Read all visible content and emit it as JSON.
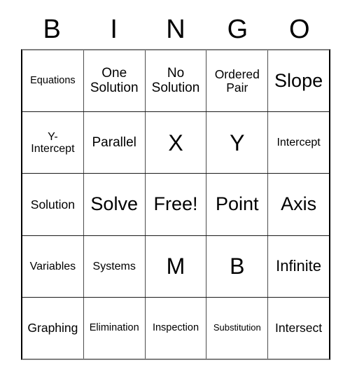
{
  "card": {
    "title": "BINGO",
    "header_letters": [
      "B",
      "I",
      "N",
      "G",
      "O"
    ],
    "free_space_label": "Free!",
    "free_space_position": {
      "row": 3,
      "column": 3
    },
    "grid_size": "5x5",
    "colors": {
      "background": "#ffffff",
      "text": "#000000",
      "grid_line": "#4d4d4d",
      "grid_border": "#000000"
    }
  },
  "grid": {
    "rows": [
      {
        "cells": [
          {
            "text": "Equations",
            "size": "s"
          },
          {
            "text": "One\nSolution",
            "size": "l"
          },
          {
            "text": "No\nSolution",
            "size": "l"
          },
          {
            "text": "Ordered\nPair",
            "size": "ml"
          },
          {
            "text": "Slope",
            "size": "xxl"
          }
        ]
      },
      {
        "cells": [
          {
            "text": "Y-\nIntercept",
            "size": "m"
          },
          {
            "text": "Parallel",
            "size": "l"
          },
          {
            "text": "X",
            "size": "big"
          },
          {
            "text": "Y",
            "size": "big"
          },
          {
            "text": "Intercept",
            "size": "m"
          }
        ]
      },
      {
        "cells": [
          {
            "text": "Solution",
            "size": "ml"
          },
          {
            "text": "Solve",
            "size": "xxl"
          },
          {
            "text": "Free!",
            "size": "xxl"
          },
          {
            "text": "Point",
            "size": "xxl"
          },
          {
            "text": "Axis",
            "size": "xxl"
          }
        ]
      },
      {
        "cells": [
          {
            "text": "Variables",
            "size": "m"
          },
          {
            "text": "Systems",
            "size": "m"
          },
          {
            "text": "M",
            "size": "big"
          },
          {
            "text": "B",
            "size": "big"
          },
          {
            "text": "Infinite",
            "size": "xl"
          }
        ]
      },
      {
        "cells": [
          {
            "text": "Graphing",
            "size": "ml"
          },
          {
            "text": "Elimination",
            "size": "s"
          },
          {
            "text": "Inspection",
            "size": "s"
          },
          {
            "text": "Substitution",
            "size": "xs"
          },
          {
            "text": "Intersect",
            "size": "ml"
          }
        ]
      }
    ]
  }
}
